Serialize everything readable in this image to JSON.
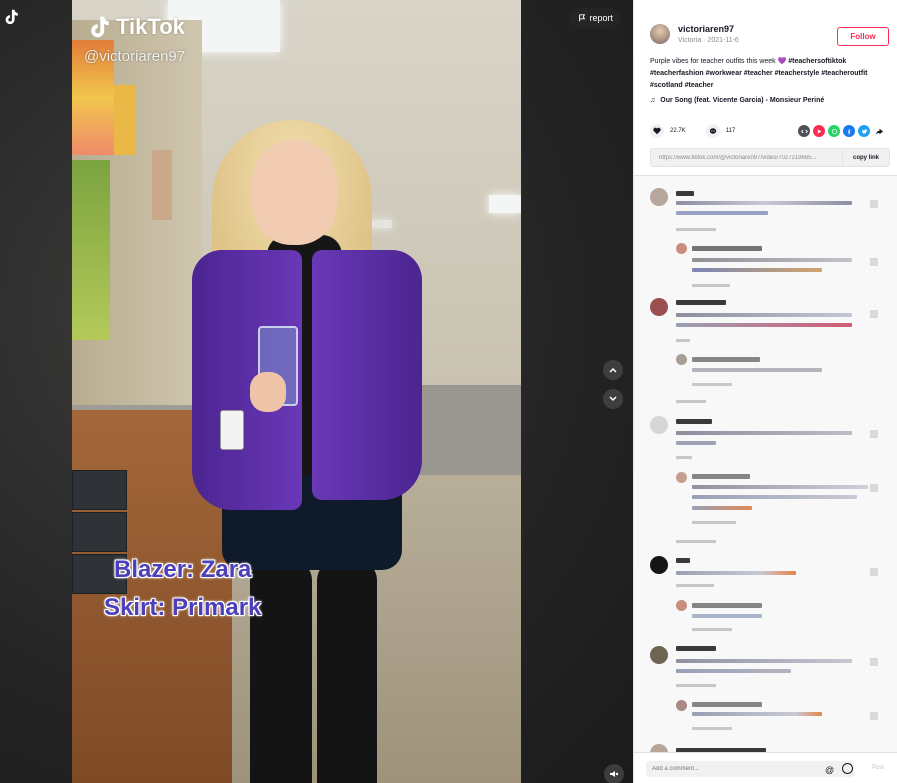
{
  "video": {
    "brand": "TikTok",
    "handle": "@victoriaren97",
    "caption_line1": "Blazer: Zara",
    "caption_line2": "Skirt: Primark",
    "report_label": "report"
  },
  "post": {
    "author_name": "victoriaren97",
    "author_sub": "Victoria · 2021-11-6",
    "follow_label": "Follow",
    "description_text": "Purple vibes for teacher outfits this week 💜 ",
    "description_tags": "#teachersoftiktok #teacherfashion #workwear #teacher #teacherstyle #teacheroutfit #scotland #teacher",
    "music": "Our Song (feat. Vicente Garcia) - Monsieur Periné",
    "likes": "22.7K",
    "comments_count": "117",
    "link_url": "https://www.tiktok.com/@victoriaren97/video/7027219665...",
    "copy_label": "copy link"
  },
  "comment_box": {
    "placeholder": "Add a comment...",
    "post_label": "Post"
  },
  "colors": {
    "accent": "#fe2c55",
    "blazer": "#5b2ea5",
    "caption": "#4c3fba"
  },
  "icons": [
    "tiktok-icon",
    "flag-icon",
    "chevron-up-icon",
    "chevron-down-icon",
    "mute-icon",
    "heart-icon",
    "comment-icon",
    "embed-icon",
    "whatsapp-icon",
    "facebook-icon",
    "twitter-icon",
    "share-icon",
    "music-note-icon",
    "at-icon",
    "emoji-icon"
  ]
}
